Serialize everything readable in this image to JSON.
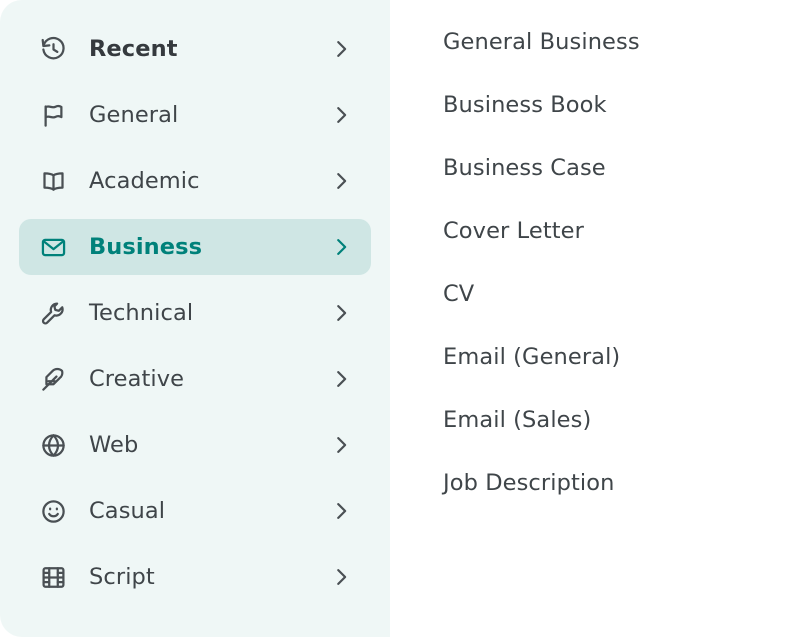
{
  "colors": {
    "sidebar_bg": "#eff7f6",
    "content_bg": "#ffffff",
    "selected_bg": "#cfe6e4",
    "accent_teal": "#00817a",
    "text_default": "#3f4549",
    "icon_default": "#4a5054"
  },
  "sidebar": {
    "items": [
      {
        "label": "Recent",
        "icon": "history-icon",
        "selected": false,
        "bold": true,
        "chevron": "chevron-right-icon"
      },
      {
        "label": "General",
        "icon": "flag-icon",
        "selected": false,
        "bold": false,
        "chevron": "chevron-right-icon"
      },
      {
        "label": "Academic",
        "icon": "book-open-icon",
        "selected": false,
        "bold": false,
        "chevron": "chevron-right-icon"
      },
      {
        "label": "Business",
        "icon": "envelope-icon",
        "selected": true,
        "bold": true,
        "chevron": "chevron-right-icon"
      },
      {
        "label": "Technical",
        "icon": "wrench-icon",
        "selected": false,
        "bold": false,
        "chevron": "chevron-right-icon"
      },
      {
        "label": "Creative",
        "icon": "feather-icon",
        "selected": false,
        "bold": false,
        "chevron": "chevron-right-icon"
      },
      {
        "label": "Web",
        "icon": "globe-icon",
        "selected": false,
        "bold": false,
        "chevron": "chevron-right-icon"
      },
      {
        "label": "Casual",
        "icon": "smiley-icon",
        "selected": false,
        "bold": false,
        "chevron": "chevron-right-icon"
      },
      {
        "label": "Script",
        "icon": "film-icon",
        "selected": false,
        "bold": false,
        "chevron": "chevron-right-icon"
      }
    ]
  },
  "content": {
    "items": [
      {
        "label": "General Business"
      },
      {
        "label": "Business Book"
      },
      {
        "label": "Business Case"
      },
      {
        "label": "Cover Letter"
      },
      {
        "label": "CV"
      },
      {
        "label": "Email (General)"
      },
      {
        "label": "Email (Sales)"
      },
      {
        "label": "Job Description"
      }
    ]
  }
}
